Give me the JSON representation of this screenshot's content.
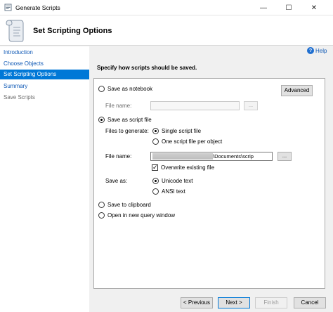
{
  "window": {
    "title": "Generate Scripts",
    "controls": {
      "minimize": "—",
      "maximize": "☐",
      "close": "✕"
    }
  },
  "header": {
    "heading": "Set Scripting Options"
  },
  "sidebar": {
    "items": [
      {
        "label": "Introduction",
        "state": "link"
      },
      {
        "label": "Choose Objects",
        "state": "link"
      },
      {
        "label": "Set Scripting Options",
        "state": "active"
      },
      {
        "label": "Summary",
        "state": "link"
      },
      {
        "label": "Save Scripts",
        "state": "disabled"
      }
    ]
  },
  "help": {
    "label": "Help"
  },
  "main": {
    "instruction": "Specify how scripts should be saved.",
    "advanced_button": "Advanced",
    "save_as_notebook": {
      "label": "Save as notebook",
      "file_name_label": "File name:",
      "file_name_value": "",
      "browse": "..."
    },
    "save_as_script_file": {
      "label": "Save as script file",
      "files_to_generate_label": "Files to generate:",
      "single_file": "Single script file",
      "one_per_object": "One script file per object",
      "file_name_label": "File name:",
      "file_name_value": "\\Documents\\scrip",
      "browse": "...",
      "overwrite": "Overwrite existing file",
      "save_as_label": "Save as:",
      "unicode": "Unicode text",
      "ansi": "ANSI text"
    },
    "save_to_clipboard": "Save to clipboard",
    "open_new_query": "Open in new query window"
  },
  "footer": {
    "previous": "< Previous",
    "next": "Next >",
    "finish": "Finish",
    "cancel": "Cancel"
  }
}
